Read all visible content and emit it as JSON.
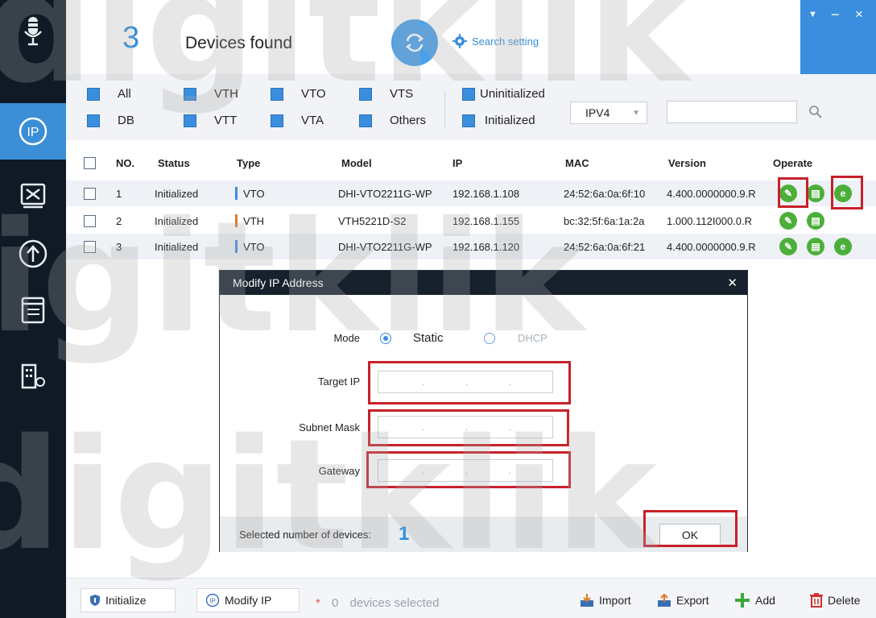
{
  "header": {
    "found_count": "3",
    "found_label": "Devices found",
    "search_setting": "Search setting"
  },
  "filters": {
    "row1": [
      "All",
      "VTH",
      "VTO",
      "VTS"
    ],
    "row2": [
      "DB",
      "VTT",
      "VTA",
      "Others"
    ],
    "state": [
      "Uninitialized",
      "Initialized"
    ],
    "ip_version": "IPV4",
    "search_placeholder": ""
  },
  "table": {
    "columns": [
      "NO.",
      "Status",
      "Type",
      "Model",
      "IP",
      "MAC",
      "Version",
      "Operate"
    ],
    "rows": [
      {
        "no": "1",
        "status": "Initialized",
        "type": "VTO",
        "model": "DHI-VTO2211G-WP",
        "ip": "192.168.1.108",
        "mac": "24:52:6a:0a:6f:10",
        "version": "4.400.0000000.9.R",
        "type_color": "#3b8ede"
      },
      {
        "no": "2",
        "status": "Initialized",
        "type": "VTH",
        "model": "VTH5221D-S2",
        "ip": "192.168.1.155",
        "mac": "bc:32:5f:6a:1a:2a",
        "version": "1.000.112I000.0.R",
        "type_color": "#e07a2a"
      },
      {
        "no": "3",
        "status": "Initialized",
        "type": "VTO",
        "model": "DHI-VTO2211G-WP",
        "ip": "192.168.1.120",
        "mac": "24:52:6a:0a:6f:21",
        "version": "4.400.0000000.9.R",
        "type_color": "#3b8ede"
      }
    ]
  },
  "modal": {
    "title": "Modify IP Address",
    "mode_label": "Mode",
    "mode_static": "Static",
    "mode_dhcp": "DHCP",
    "target_ip_label": "Target IP",
    "subnet_label": "Subnet Mask",
    "gateway_label": "Gateway",
    "selected_label": "Selected number of devices:",
    "selected_count": "1",
    "ok_label": "OK"
  },
  "bottom": {
    "initialize": "Initialize",
    "modify_ip": "Modify IP",
    "selected_count": "0",
    "selected_text": "devices selected",
    "import": "Import",
    "export": "Export",
    "add": "Add",
    "delete": "Delete"
  },
  "watermark": "digitklik",
  "colors": {
    "accent": "#3b8ede",
    "sidebar": "#0f1a26",
    "highlight": "#c8202a",
    "op_green": "#4caf3a"
  }
}
